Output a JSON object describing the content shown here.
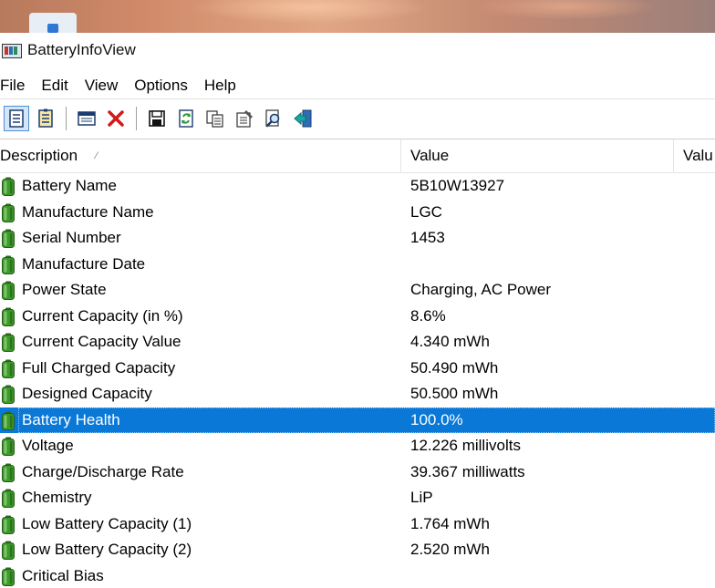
{
  "window": {
    "title": "BatteryInfoView"
  },
  "menu": [
    "File",
    "Edit",
    "View",
    "Options",
    "Help"
  ],
  "toolbar": {
    "buttons": [
      {
        "icon": "properties-icon"
      },
      {
        "icon": "battery-log-icon"
      },
      {
        "icon": "window-icon"
      },
      {
        "icon": "close-x-icon"
      },
      {
        "icon": "save-icon"
      },
      {
        "icon": "refresh-icon"
      },
      {
        "icon": "copy-icon"
      },
      {
        "icon": "properties-sheet-icon"
      },
      {
        "icon": "find-icon"
      },
      {
        "icon": "exit-icon"
      }
    ]
  },
  "list": {
    "columns": [
      "Description",
      "Value",
      "Valu"
    ],
    "sort_indicator": "⁄",
    "selected_row": 9,
    "rows": [
      {
        "description": "Battery Name",
        "value": "5B10W13927"
      },
      {
        "description": "Manufacture Name",
        "value": "LGC"
      },
      {
        "description": "Serial Number",
        "value": " 1453"
      },
      {
        "description": "Manufacture Date",
        "value": ""
      },
      {
        "description": "Power State",
        "value": "Charging, AC Power"
      },
      {
        "description": "Current Capacity (in %)",
        "value": "8.6%"
      },
      {
        "description": "Current Capacity Value",
        "value": "4.340 mWh"
      },
      {
        "description": "Full Charged Capacity",
        "value": "50.490 mWh"
      },
      {
        "description": "Designed Capacity",
        "value": "50.500 mWh"
      },
      {
        "description": "Battery Health",
        "value": "100.0%"
      },
      {
        "description": "Voltage",
        "value": "12.226 millivolts"
      },
      {
        "description": "Charge/Discharge Rate",
        "value": "39.367 milliwatts"
      },
      {
        "description": "Chemistry",
        "value": "LiP"
      },
      {
        "description": "Low Battery Capacity (1)",
        "value": "1.764 mWh"
      },
      {
        "description": "Low Battery Capacity (2)",
        "value": "2.520 mWh"
      },
      {
        "description": "Critical Bias",
        "value": ""
      }
    ]
  },
  "colors": {
    "selection": "#0a78d7",
    "battery_green": "#3c9a2a"
  }
}
